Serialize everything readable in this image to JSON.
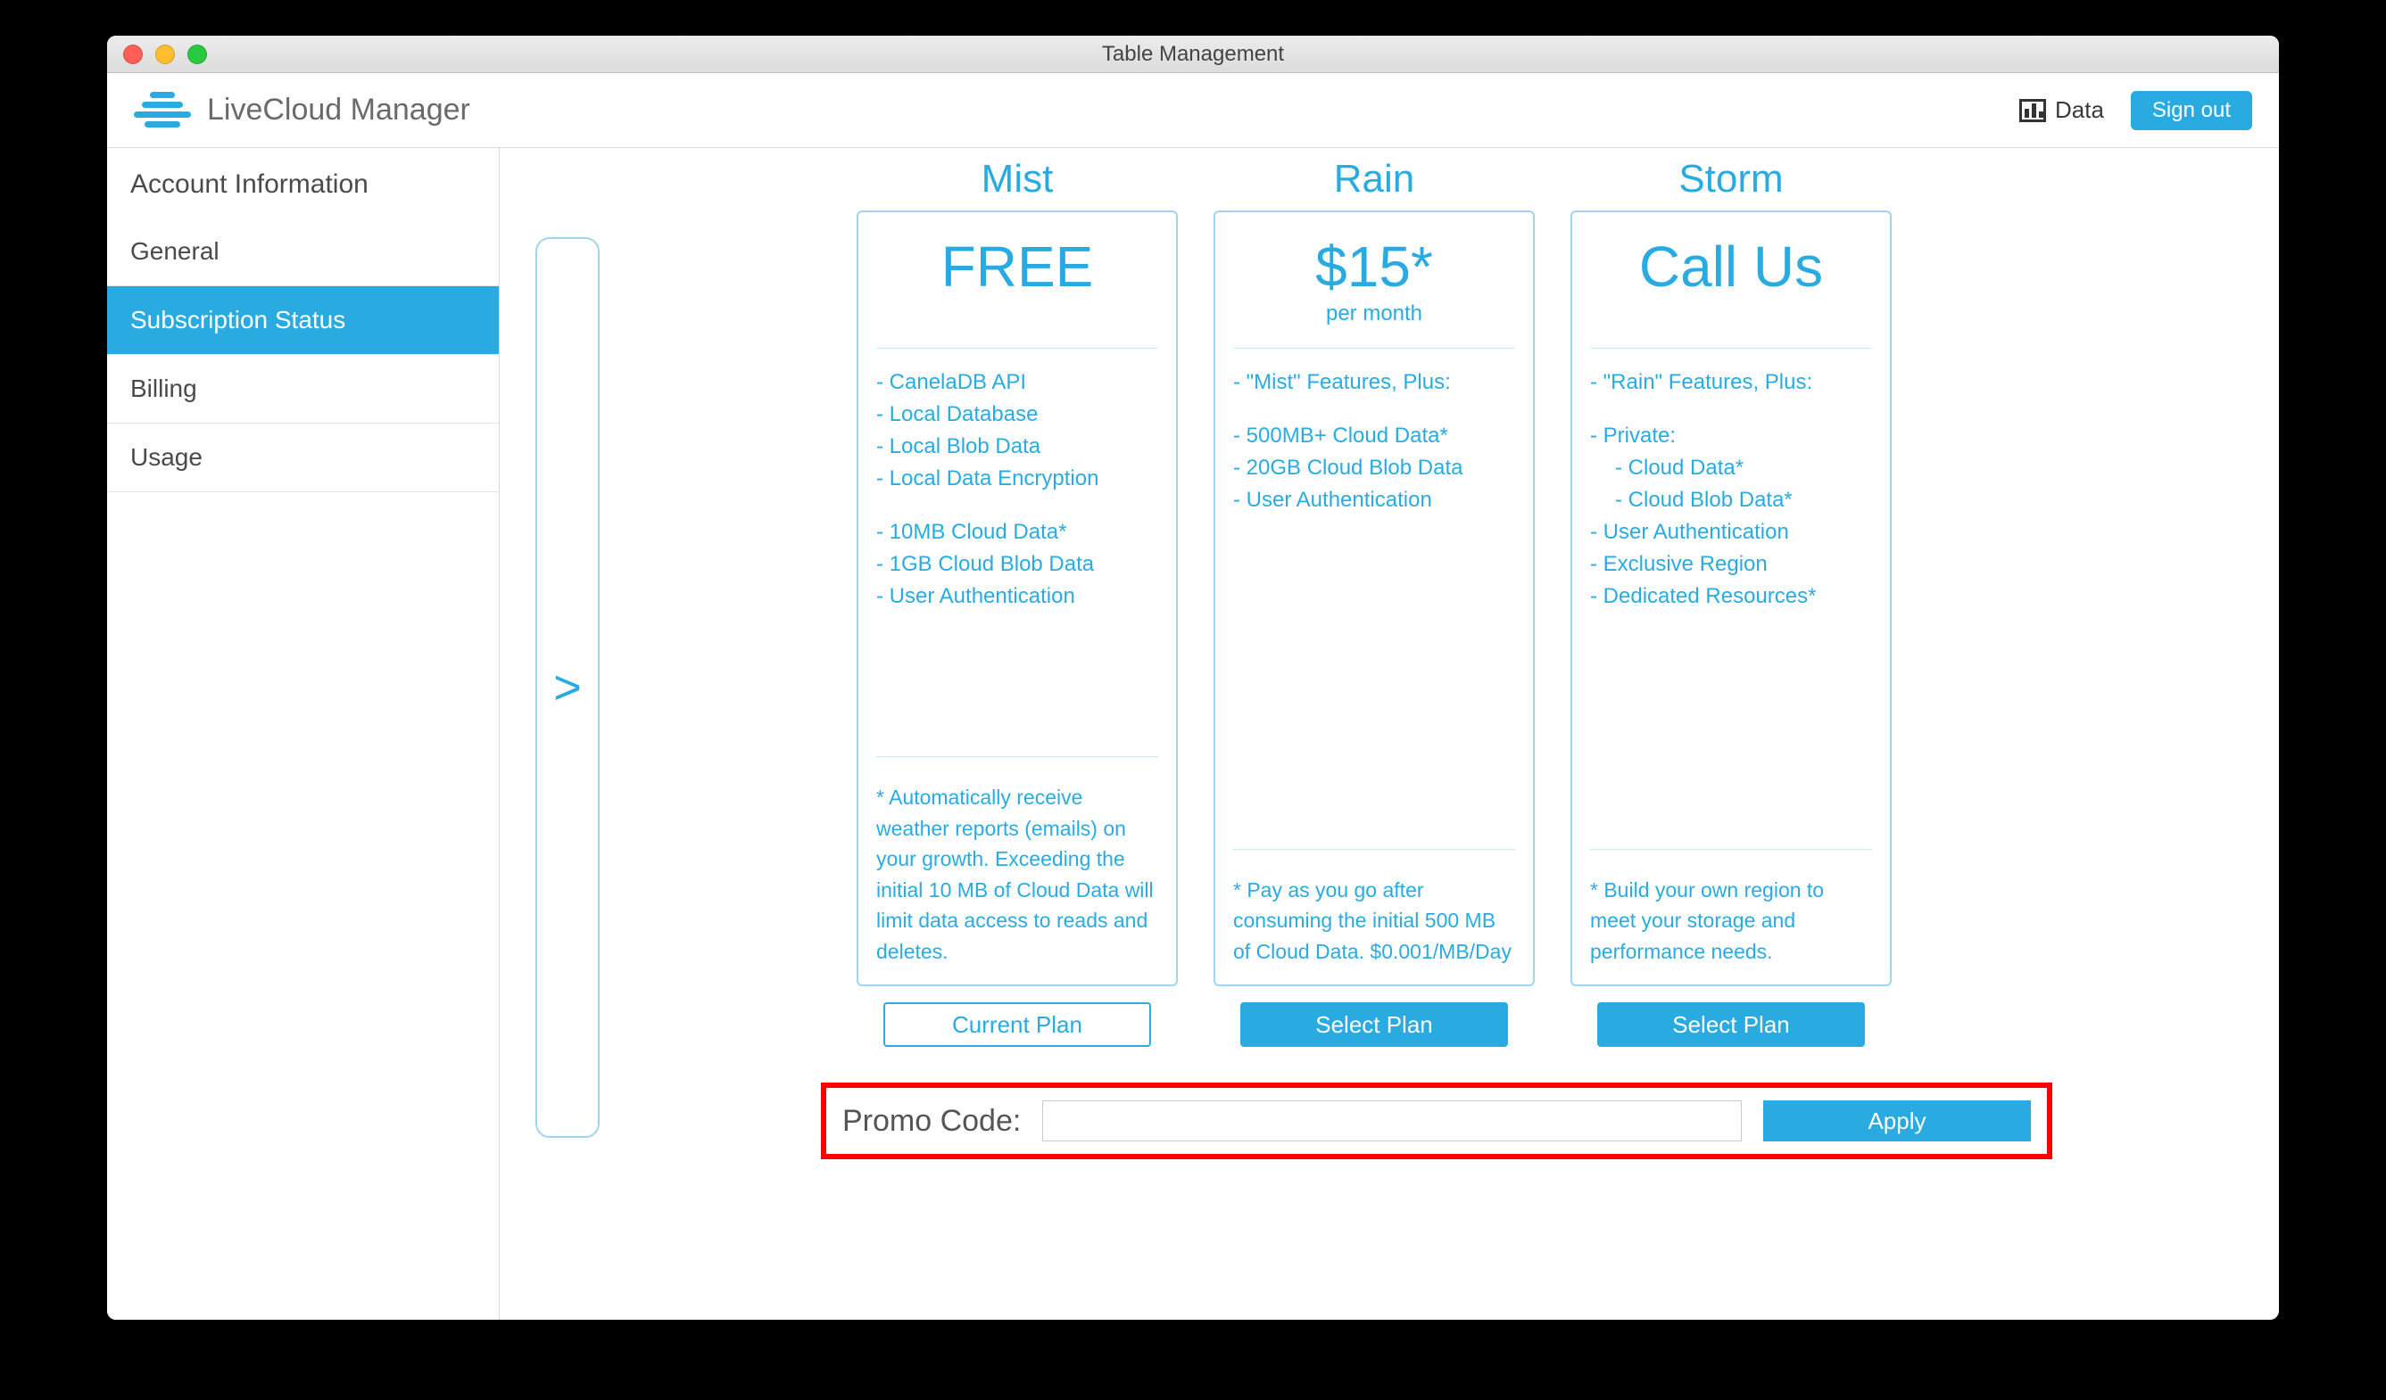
{
  "window": {
    "title": "Table Management"
  },
  "header": {
    "app_name": "LiveCloud Manager",
    "data_label": "Data",
    "signout_label": "Sign out"
  },
  "sidebar": {
    "heading": "Account Information",
    "items": [
      {
        "label": "General",
        "active": false
      },
      {
        "label": "Subscription Status",
        "active": true
      },
      {
        "label": "Billing",
        "active": false
      },
      {
        "label": "Usage",
        "active": false
      }
    ]
  },
  "main": {
    "expand_glyph": ">"
  },
  "plans": [
    {
      "name": "Mist",
      "price": "FREE",
      "price_sub": "",
      "features": [
        "- CanelaDB API",
        "- Local Database",
        "- Local Blob Data",
        "- Local Data Encryption",
        "- 10MB Cloud Data*",
        "- 1GB Cloud Blob Data",
        "- User Authentication"
      ],
      "note": "* Automatically receive weather reports (emails) on your growth. Exceeding the initial 10 MB of Cloud Data will limit data access to reads and deletes.",
      "button_label": "Current Plan",
      "button_style": "outline"
    },
    {
      "name": "Rain",
      "price": "$15*",
      "price_sub": "per month",
      "features": [
        "- \"Mist\" Features, Plus:",
        "- 500MB+ Cloud Data*",
        "- 20GB Cloud Blob Data",
        "- User Authentication"
      ],
      "note": "* Pay as you go after consuming the initial 500 MB of Cloud Data. $0.001/MB/Day",
      "button_label": "Select Plan",
      "button_style": "solid"
    },
    {
      "name": "Storm",
      "price": "Call Us",
      "price_sub": "",
      "features": [
        "- \"Rain\" Features, Plus:",
        "- Private:",
        "- Cloud Data*",
        "- Cloud Blob Data*",
        "- User Authentication",
        "- Exclusive Region",
        "- Dedicated Resources*"
      ],
      "note": "* Build your own region to meet your storage and performance needs.",
      "button_label": "Select Plan",
      "button_style": "solid"
    }
  ],
  "promo": {
    "label": "Promo Code:",
    "value": "",
    "apply_label": "Apply"
  },
  "colors": {
    "accent": "#29ABE2",
    "highlight_border": "#ff0000"
  }
}
